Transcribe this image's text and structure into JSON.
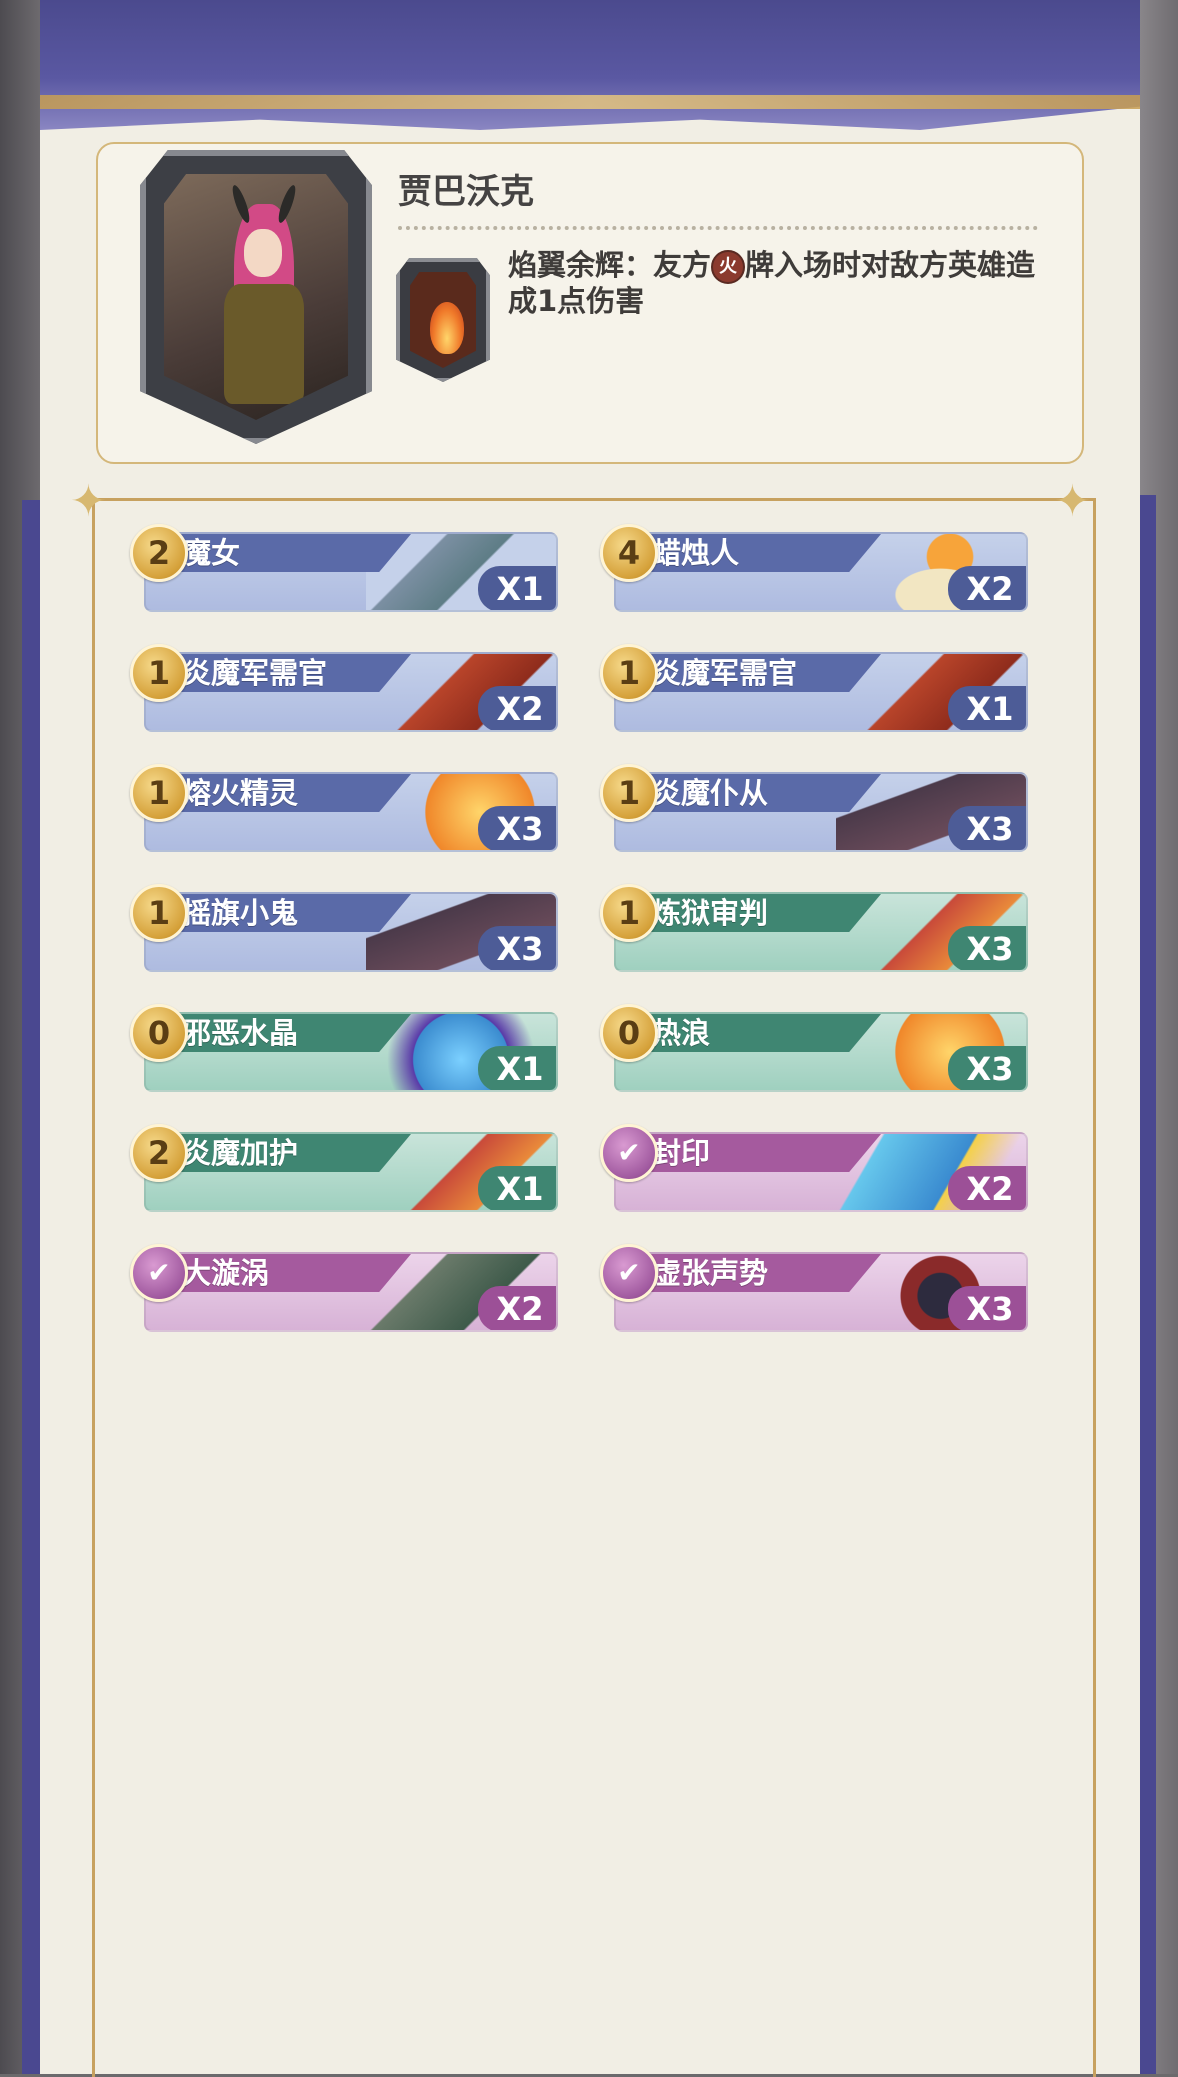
{
  "hero": {
    "name": "贾巴沃克",
    "skill_title": "焰翼余辉：友方",
    "skill_badge": "火",
    "skill_rest": "牌入场时对敌方英雄造成1点伤害"
  },
  "deck": {
    "left": [
      {
        "cost": "2",
        "name": "魔女",
        "qty": "X1",
        "type": "blue"
      },
      {
        "cost": "1",
        "name": "炎魔军需官",
        "qty": "X2",
        "type": "blue"
      },
      {
        "cost": "1",
        "name": "熔火精灵",
        "qty": "X3",
        "type": "blue"
      },
      {
        "cost": "1",
        "name": "摇旗小鬼",
        "qty": "X3",
        "type": "blue"
      },
      {
        "cost": "0",
        "name": "邪恶水晶",
        "qty": "X1",
        "type": "green"
      },
      {
        "cost": "2",
        "name": "炎魔加护",
        "qty": "X1",
        "type": "green"
      },
      {
        "cost": "spell",
        "name": "大漩涡",
        "qty": "X2",
        "type": "pink"
      }
    ],
    "right": [
      {
        "cost": "4",
        "name": "蜡烛人",
        "qty": "X2",
        "type": "blue"
      },
      {
        "cost": "1",
        "name": "炎魔军需官",
        "qty": "X1",
        "type": "blue"
      },
      {
        "cost": "1",
        "name": "炎魔仆从",
        "qty": "X3",
        "type": "blue"
      },
      {
        "cost": "1",
        "name": "炼狱审判",
        "qty": "X3",
        "type": "green"
      },
      {
        "cost": "0",
        "name": "热浪",
        "qty": "X3",
        "type": "green"
      },
      {
        "cost": "spell",
        "name": "封印",
        "qty": "X2",
        "type": "pink"
      },
      {
        "cost": "spell",
        "name": "虚张声势",
        "qty": "X3",
        "type": "pink"
      }
    ]
  },
  "icons": {
    "spell_cost": "check-arrow-icon",
    "skill": "flame-icon"
  },
  "colors": {
    "minion_blue": "#5a6aa8",
    "spell_green": "#3f8672",
    "special_pink": "#a55a9e",
    "gold": "#d5a13a"
  }
}
